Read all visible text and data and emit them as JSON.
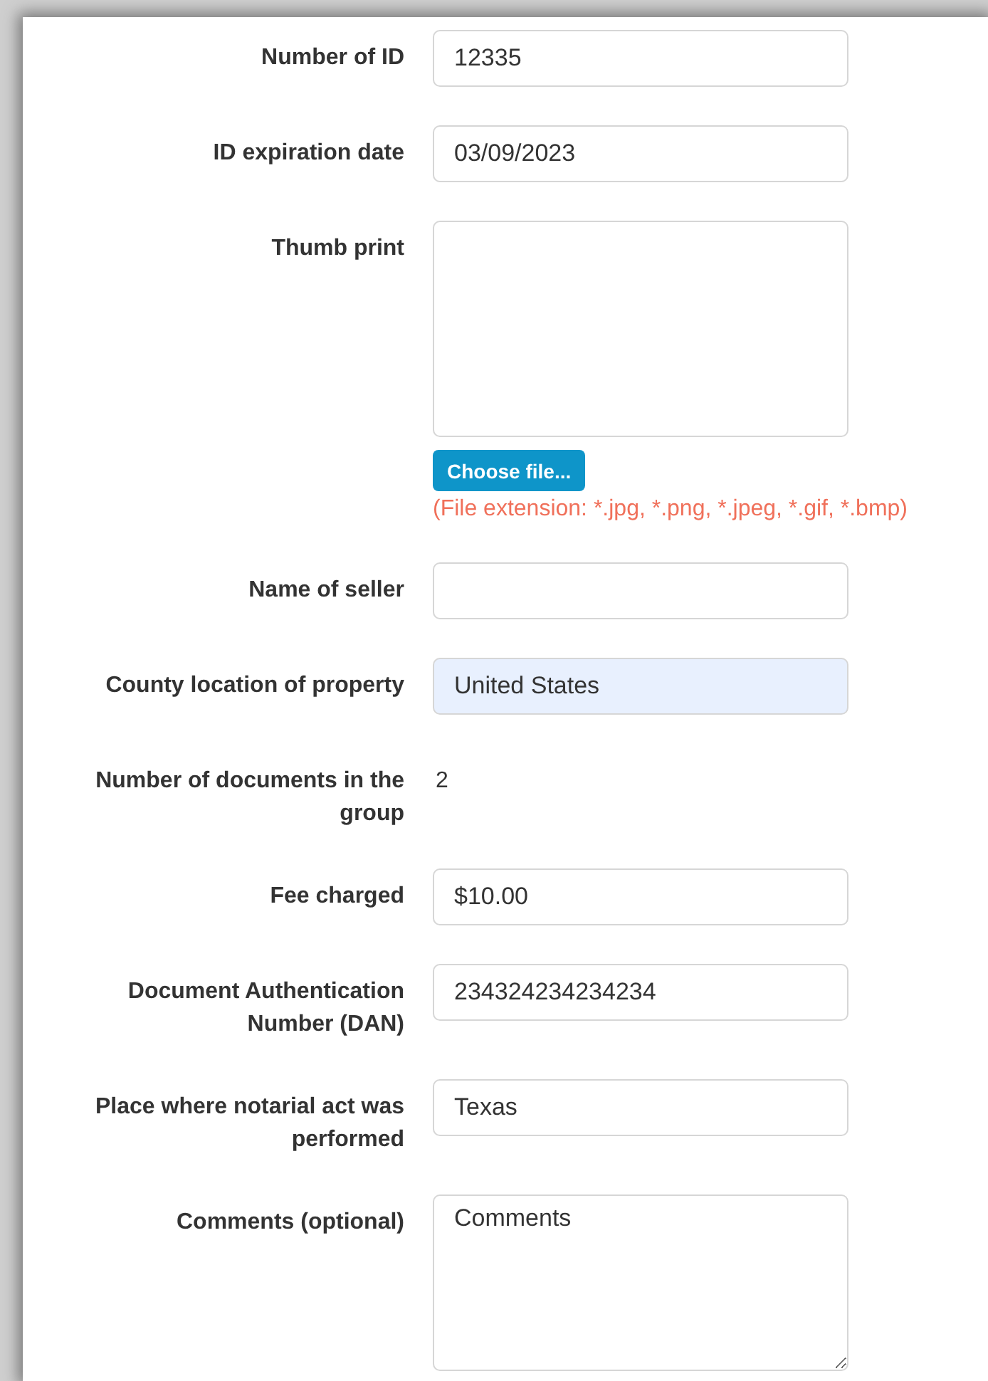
{
  "fields": [
    {
      "kind": "text",
      "label": "Number of ID",
      "value": "12335"
    },
    {
      "kind": "text",
      "label": "ID expiration date",
      "value": "03/09/2023"
    },
    {
      "kind": "file",
      "label": "Thumb print",
      "button": "Choose file...",
      "hint": "(File extension: *.jpg, *.png, *.jpeg, *.gif, *.bmp)"
    },
    {
      "kind": "text",
      "label": "Name of seller"
    },
    {
      "kind": "text",
      "label": "County location of property",
      "value": "United States",
      "autofilled": true
    },
    {
      "kind": "static",
      "label": "Number of documents in the group",
      "value": "2"
    },
    {
      "kind": "text",
      "label": "Fee charged",
      "value": "$10.00"
    },
    {
      "kind": "text",
      "label": "Document Authentication Number (DAN)",
      "value": "234324234234234"
    },
    {
      "kind": "text",
      "label": "Place where notarial act was performed",
      "value": "Texas"
    },
    {
      "kind": "textarea",
      "label": "Comments (optional)",
      "value": "Comments"
    }
  ]
}
